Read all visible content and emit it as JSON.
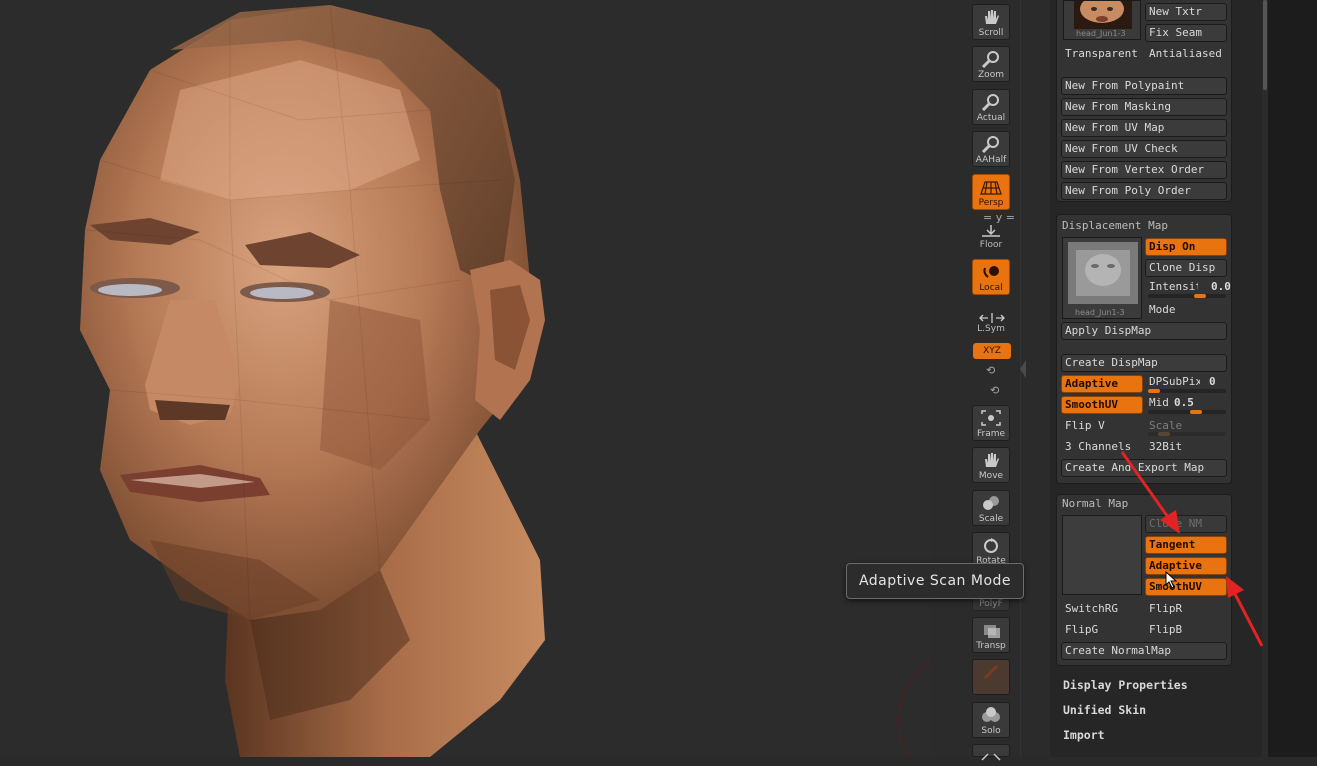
{
  "viewport": {
    "tooltip": "Adaptive Scan Mode"
  },
  "shelf": {
    "scroll": "Scroll",
    "zoom": "Zoom",
    "actual": "Actual",
    "aahalf": "AAHalf",
    "persp": "Persp",
    "floor": "Floor",
    "local": "Local",
    "lsym": "L.Sym",
    "xyz": "XYZ",
    "frame": "Frame",
    "move": "Move",
    "scale": "Scale",
    "rotate": "Rotate",
    "polyf": "PolyF",
    "transp": "Transp",
    "solo": "Solo"
  },
  "texture_map": {
    "thumb_caption": "head_Jun1-3",
    "new_txtr": "New Txtr",
    "fix_seam": "Fix Seam",
    "transparent": "Transparent",
    "antialiased": "Antialiased",
    "buttons": [
      "New From Polypaint",
      "New From Masking",
      "New From UV Map",
      "New From UV Check",
      "New From Vertex Order",
      "New From Poly Order"
    ]
  },
  "displacement_map": {
    "title": "Displacement Map",
    "thumb_caption": "head_Jun1-3",
    "disp_on": "Disp On",
    "clone_disp": "Clone Disp",
    "intensity_label": "Intensity",
    "intensity_value": "0.0",
    "mode": "Mode",
    "apply_dispmap": "Apply DispMap",
    "create_dispmap": "Create DispMap",
    "adaptive": "Adaptive",
    "dpsubpix_label": "DPSubPix",
    "dpsubpix_value": "0",
    "smoothuv": "SmoothUV",
    "mid_label": "Mid",
    "mid_value": "0.5",
    "flip_v": "Flip V",
    "scale": "Scale",
    "channels": "3 Channels",
    "bit": "32Bit",
    "create_export": "Create And Export Map"
  },
  "normal_map": {
    "title": "Normal Map",
    "clone_nm": "Clone NM",
    "tangent": "Tangent",
    "adaptive": "Adaptive",
    "smoothuv": "SmoothUV",
    "switchrg": "SwitchRG",
    "flipr": "FlipR",
    "flipg": "FlipG",
    "flipb": "FlipB",
    "create_normalmap": "Create NormalMap"
  },
  "menu": {
    "display_properties": "Display Properties",
    "unified_skin": "Unified Skin",
    "import": "Import"
  },
  "colors": {
    "accent": "#e8730f",
    "panel_bg": "#262626",
    "button_bg": "#3b3b3b",
    "annotation_red": "#e02424"
  },
  "toggles": {
    "persp": true,
    "local": true,
    "xyz": true,
    "disp_on": true,
    "disp_adaptive": true,
    "disp_smoothuv": true,
    "nm_tangent": true,
    "nm_adaptive": true,
    "nm_smoothuv": true
  },
  "sliders": {
    "intensity": 0.0,
    "dpsubpix": 0,
    "mid": 0.5
  }
}
